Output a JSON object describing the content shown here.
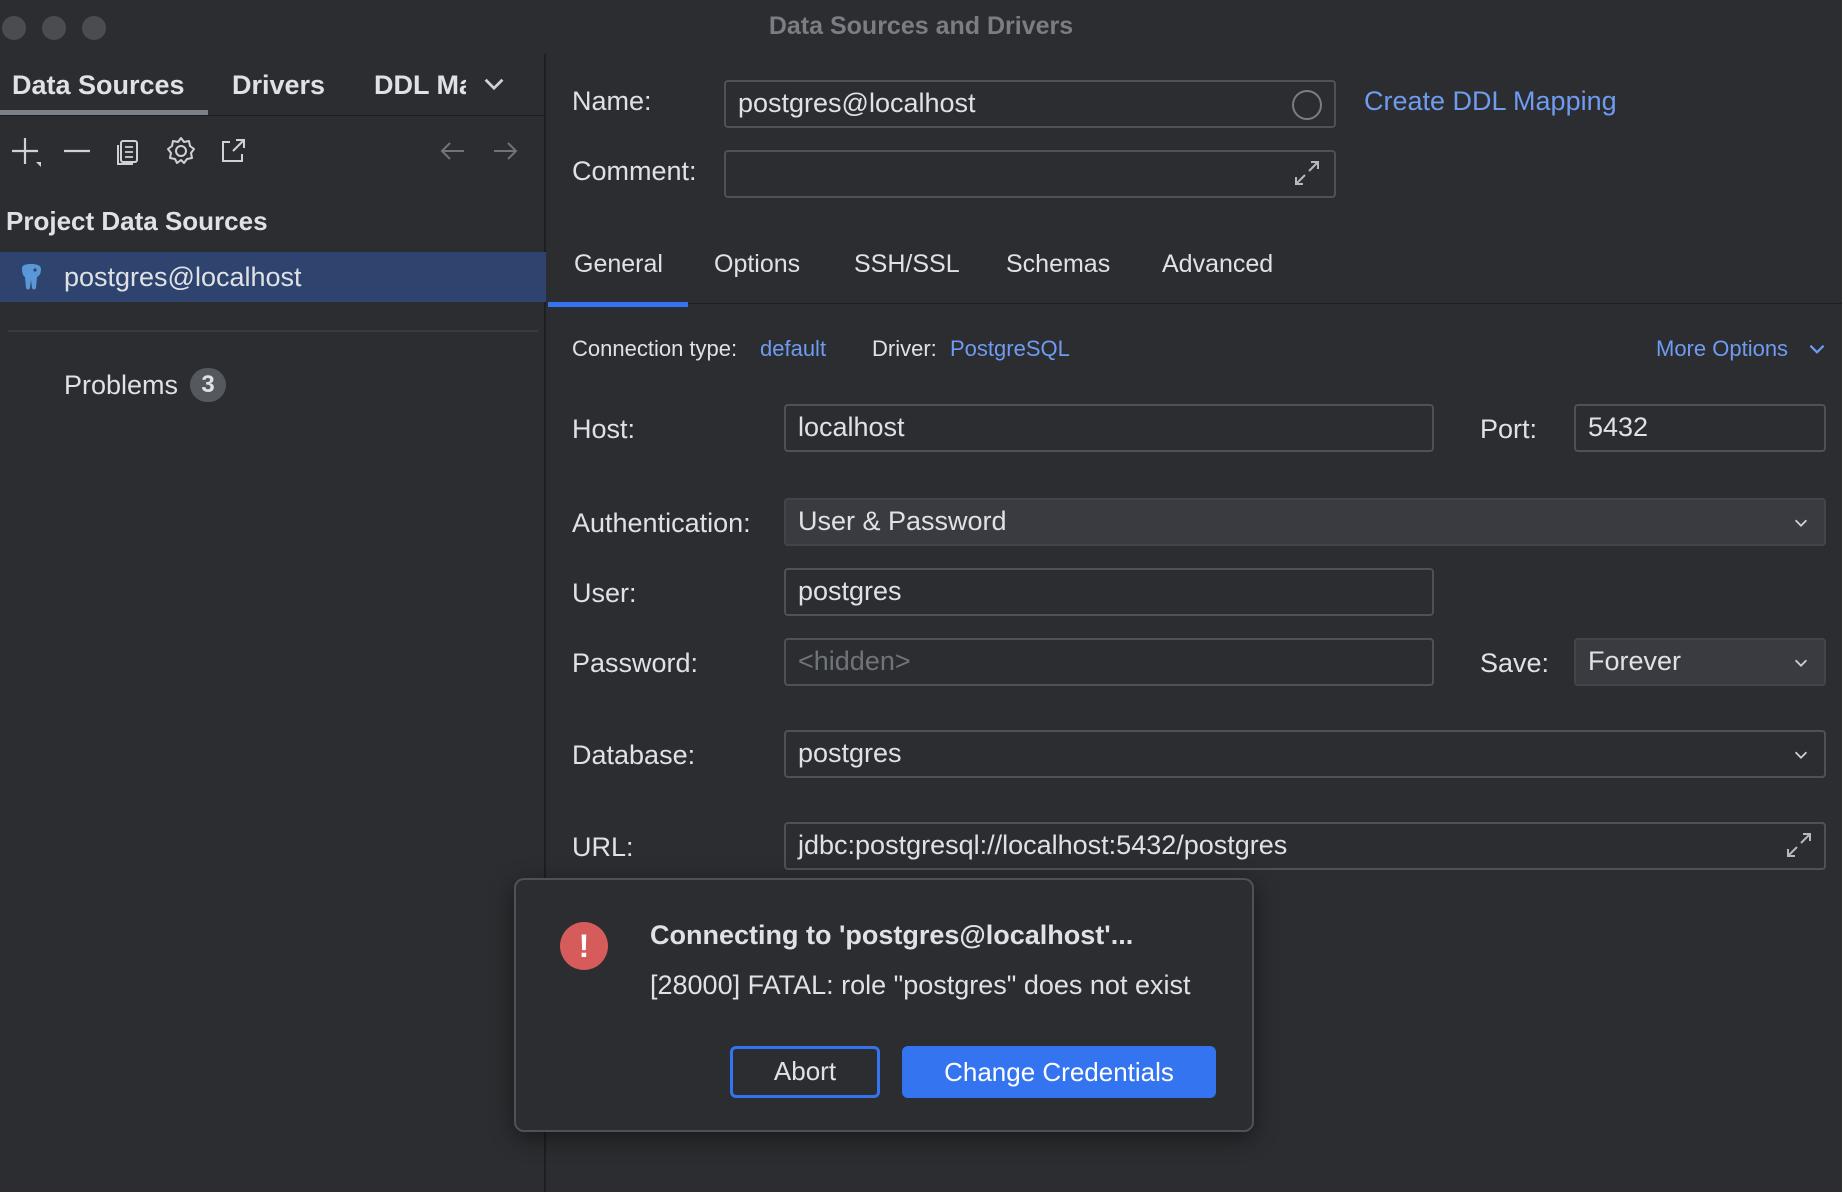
{
  "window": {
    "title": "Data Sources and Drivers"
  },
  "left": {
    "tabs": [
      "Data Sources",
      "Drivers",
      "DDL Ma"
    ],
    "toolbar": [
      "add-icon",
      "remove-icon",
      "copy-icon",
      "settings-icon",
      "open-external-icon",
      "back-arrow-icon",
      "forward-arrow-icon"
    ],
    "section_title": "Project Data Sources",
    "selected_item": "postgres@localhost",
    "problems_label": "Problems",
    "problems_count": "3"
  },
  "form": {
    "name_label": "Name:",
    "name_value": "postgres@localhost",
    "create_ddl_link": "Create DDL Mapping",
    "comment_label": "Comment:",
    "comment_value": "",
    "tabs": [
      "General",
      "Options",
      "SSH/SSL",
      "Schemas",
      "Advanced"
    ],
    "active_tab": "General",
    "connection_type_label": "Connection type:",
    "connection_type_value": "default",
    "driver_label": "Driver:",
    "driver_value": "PostgreSQL",
    "more_options": "More Options",
    "host_label": "Host:",
    "host_value": "localhost",
    "port_label": "Port:",
    "port_value": "5432",
    "auth_label": "Authentication:",
    "auth_value": "User & Password",
    "user_label": "User:",
    "user_value": "postgres",
    "password_label": "Password:",
    "password_placeholder": "<hidden>",
    "save_label": "Save:",
    "save_value": "Forever",
    "database_label": "Database:",
    "database_value": "postgres",
    "url_label": "URL:",
    "url_value": "jdbc:postgresql://localhost:5432/postgres"
  },
  "dialog": {
    "title": "Connecting to 'postgres@localhost'...",
    "message": "[28000] FATAL: role \"postgres\" does not exist",
    "abort_label": "Abort",
    "change_credentials_label": "Change Credentials"
  },
  "colors": {
    "background": "#2b2d30",
    "accent": "#3574f0",
    "link": "#6f9bf0",
    "selection": "#2e436e",
    "error": "#d65c5c"
  }
}
